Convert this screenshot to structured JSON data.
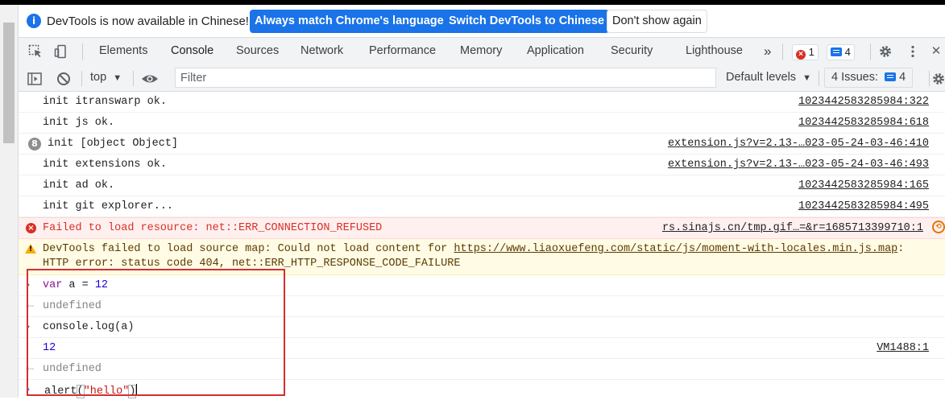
{
  "infobar": {
    "message": "DevTools is now available in Chinese!",
    "btn_match": "Always match Chrome's language",
    "btn_switch": "Switch DevTools to Chinese",
    "btn_dismiss": "Don't show again",
    "icon": "info-icon"
  },
  "tabs": [
    "Elements",
    "Console",
    "Sources",
    "Network",
    "Performance",
    "Memory",
    "Application",
    "Security",
    "Lighthouse"
  ],
  "active_tab": "Console",
  "more_tabs_glyph": "»",
  "error_count": "1",
  "message_count": "4",
  "toolbar": {
    "context": "top",
    "filter_placeholder": "Filter",
    "levels": "Default levels",
    "issues_label": "4 Issues:",
    "issues_count": "4"
  },
  "logs": [
    {
      "text": "init itranswarp ok.",
      "source": "1023442583285984:322"
    },
    {
      "text": "init js ok.",
      "source": "1023442583285984:618"
    },
    {
      "count": "8",
      "text": "init [object Object]",
      "source": "extension.js?v=2.13-…023-05-24-03-46:410"
    },
    {
      "text": "init extensions ok.",
      "source": "extension.js?v=2.13-…023-05-24-03-46:493"
    },
    {
      "text": "init ad ok.",
      "source": "1023442583285984:165"
    },
    {
      "text": "init git explorer...",
      "source": "1023442583285984:495"
    }
  ],
  "error_row": {
    "text": "Failed to load resource: net::ERR_CONNECTION_REFUSED",
    "source": "rs.sinajs.cn/tmp.gif…=&r=1685713399710:1"
  },
  "warning_row": {
    "line1_prefix": "DevTools failed to load source map: Could not load content for ",
    "url": "https://www.liaoxuefeng.com/static/js/moment-with-locales.min.js.map",
    "line1_suffix": ":",
    "line2": "HTTP error: status code 404, net::ERR_HTTP_RESPONSE_CODE_FAILURE"
  },
  "repl": {
    "in1_kw": "var",
    "in1_mid": " a = ",
    "in1_num": "12",
    "out1": "undefined",
    "in2": "console.log(a)",
    "log_value": "12",
    "log_source": "VM1488:1",
    "out2": "undefined",
    "current_pre": "alert",
    "current_open": "(",
    "current_str": "\"hello\"",
    "current_close": ")"
  },
  "colors": {
    "accent": "#1a73e8",
    "error": "#d93025",
    "warning": "#f9ab00",
    "highlight_box": "#d32f2f"
  }
}
